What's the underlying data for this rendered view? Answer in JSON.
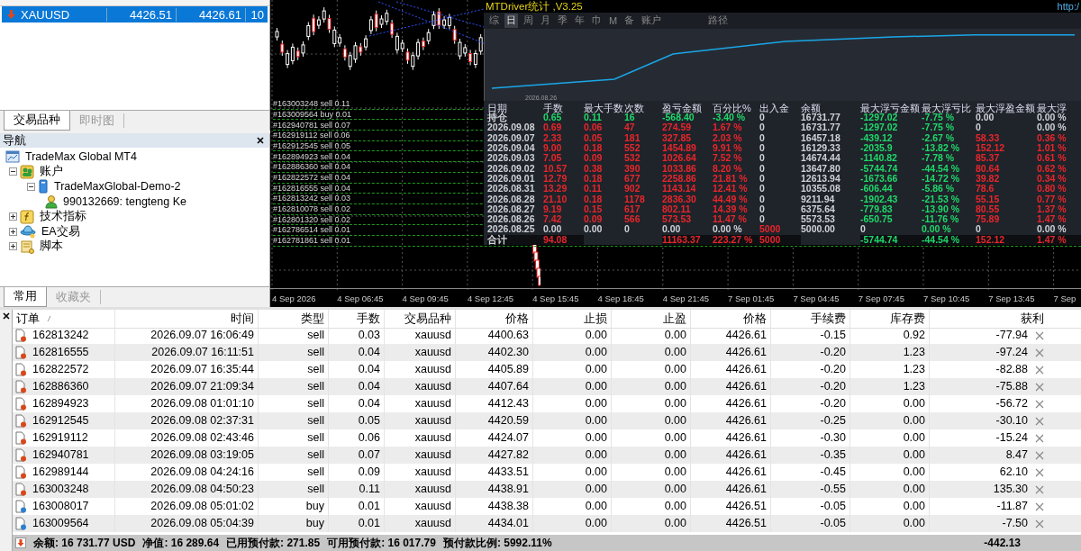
{
  "market_watch": {
    "rows": [
      {
        "symbol": "XAUUSD",
        "bid": "4426.51",
        "ask": "4426.61",
        "spread": "10",
        "selected": true
      }
    ],
    "tabs": [
      {
        "label": "交易品种",
        "selected": true
      },
      {
        "label": "即时图",
        "selected": false
      }
    ]
  },
  "navigator": {
    "title": "导航",
    "tree": {
      "label": "TradeMax Global MT4",
      "kind": "terminal",
      "children": [
        {
          "label": "账户",
          "kind": "accounts",
          "expanded": true,
          "children": [
            {
              "label": "TradeMaxGlobal-Demo-2",
              "kind": "server",
              "expanded": true,
              "children": [
                {
                  "label": "990132669: tengteng Ke",
                  "kind": "user"
                }
              ]
            }
          ]
        },
        {
          "label": "技术指标",
          "kind": "indicators",
          "expanded": false
        },
        {
          "label": "EA交易",
          "kind": "experts",
          "expanded": false
        },
        {
          "label": "脚本",
          "kind": "scripts",
          "expanded": false
        }
      ]
    },
    "tabs": [
      {
        "label": "常用",
        "selected": true
      },
      {
        "label": "收藏夹",
        "selected": false
      }
    ]
  },
  "chart": {
    "order_labels": [
      "#163003248 sell 0.11",
      "#163009564 buy 0.01",
      "#162940781 sell 0.07",
      "#162919112 sell 0.06",
      "#162912545 sell 0.05",
      "#162894923 sell 0.04",
      "#162886360 sell 0.04",
      "#162822572 sell 0.04",
      "#162816555 sell 0.04",
      "#162813242 sell 0.03",
      "#162810078 sell 0.02",
      "#162801320 sell 0.02",
      "#162786514 sell 0.01",
      "#162781861 sell 0.01"
    ],
    "time_axis": [
      "4 Sep 2026",
      "4 Sep 06:45",
      "4 Sep 09:45",
      "4 Sep 12:45",
      "4 Sep 15:45",
      "4 Sep 18:45",
      "4 Sep 21:45",
      "7 Sep 01:45",
      "7 Sep 04:45",
      "7 Sep 07:45",
      "7 Sep 10:45",
      "7 Sep 13:45",
      "7 Sep"
    ]
  },
  "stats_panel": {
    "title": "MTDriver统计 ,V3.25",
    "url": "http:/",
    "tabs": [
      {
        "label": "综",
        "selected": false
      },
      {
        "label": "日",
        "selected": true
      },
      {
        "label": "周",
        "selected": false
      },
      {
        "label": "月",
        "selected": false
      },
      {
        "label": "季",
        "selected": false
      },
      {
        "label": "年",
        "selected": false
      },
      {
        "label": "巾",
        "selected": false
      },
      {
        "label": "M",
        "selected": false
      },
      {
        "label": "备",
        "selected": false
      },
      {
        "label": "账户",
        "selected": false
      },
      {
        "label": "路径",
        "selected": false
      }
    ],
    "curve_start_label": "2026.08.26",
    "columns": [
      "日期",
      "手数",
      "最大手数",
      "次数",
      "盈亏金额",
      "百分比%",
      "出入金",
      "余额",
      "最大浮亏金额",
      "最大浮亏比",
      "最大浮盈金额",
      "最大浮"
    ],
    "rows": [
      {
        "cells": [
          {
            "text": "持仓",
            "color": "#cfd3d8"
          },
          {
            "text": "0.65",
            "color": "#1fd86a"
          },
          {
            "text": "0.11",
            "color": "#1fd86a"
          },
          {
            "text": "16",
            "color": "#1fd86a"
          },
          {
            "text": "-568.40",
            "color": "#1fd86a"
          },
          {
            "text": "-3.40 %",
            "color": "#1fd86a"
          },
          {
            "text": "0",
            "color": "#cfd3d8"
          },
          {
            "text": "16731.77",
            "color": "#cfd3d8"
          },
          {
            "text": "-1297.02",
            "color": "#1fd86a"
          },
          {
            "text": "-7.75 %",
            "color": "#1fd86a"
          },
          {
            "text": "0.00",
            "color": "#cfd3d8"
          },
          {
            "text": "0.00 %",
            "color": "#cfd3d8"
          }
        ]
      },
      {
        "cells": [
          {
            "text": "2026.09.08",
            "color": "#cfd3d8"
          },
          {
            "text": "0.69",
            "color": "#e8262b"
          },
          {
            "text": "0.06",
            "color": "#e8262b"
          },
          {
            "text": "47",
            "color": "#e8262b"
          },
          {
            "text": "274.59",
            "color": "#e8262b"
          },
          {
            "text": "1.67 %",
            "color": "#e8262b"
          },
          {
            "text": "0",
            "color": "#cfd3d8"
          },
          {
            "text": "16731.77",
            "color": "#cfd3d8"
          },
          {
            "text": "-1297.02",
            "color": "#1fd86a"
          },
          {
            "text": "-7.75 %",
            "color": "#1fd86a"
          },
          {
            "text": "0",
            "color": "#cfd3d8"
          },
          {
            "text": "0.00 %",
            "color": "#cfd3d8"
          }
        ]
      },
      {
        "cells": [
          {
            "text": "2026.09.07",
            "color": "#cfd3d8"
          },
          {
            "text": "2.33",
            "color": "#e8262b"
          },
          {
            "text": "0.05",
            "color": "#e8262b"
          },
          {
            "text": "181",
            "color": "#e8262b"
          },
          {
            "text": "327.85",
            "color": "#e8262b"
          },
          {
            "text": "2.03 %",
            "color": "#e8262b"
          },
          {
            "text": "0",
            "color": "#cfd3d8"
          },
          {
            "text": "16457.18",
            "color": "#cfd3d8"
          },
          {
            "text": "-439.12",
            "color": "#1fd86a"
          },
          {
            "text": "-2.67 %",
            "color": "#1fd86a"
          },
          {
            "text": "58.33",
            "color": "#e8262b"
          },
          {
            "text": "0.36 %",
            "color": "#e8262b"
          }
        ]
      },
      {
        "cells": [
          {
            "text": "2026.09.04",
            "color": "#cfd3d8"
          },
          {
            "text": "9.00",
            "color": "#e8262b"
          },
          {
            "text": "0.18",
            "color": "#e8262b"
          },
          {
            "text": "552",
            "color": "#e8262b"
          },
          {
            "text": "1454.89",
            "color": "#e8262b"
          },
          {
            "text": "9.91 %",
            "color": "#e8262b"
          },
          {
            "text": "0",
            "color": "#cfd3d8"
          },
          {
            "text": "16129.33",
            "color": "#cfd3d8"
          },
          {
            "text": "-2035.9",
            "color": "#1fd86a"
          },
          {
            "text": "-13.82 %",
            "color": "#1fd86a"
          },
          {
            "text": "152.12",
            "color": "#e8262b"
          },
          {
            "text": "1.01 %",
            "color": "#e8262b"
          }
        ]
      },
      {
        "cells": [
          {
            "text": "2026.09.03",
            "color": "#cfd3d8"
          },
          {
            "text": "7.05",
            "color": "#e8262b"
          },
          {
            "text": "0.09",
            "color": "#e8262b"
          },
          {
            "text": "532",
            "color": "#e8262b"
          },
          {
            "text": "1026.64",
            "color": "#e8262b"
          },
          {
            "text": "7.52 %",
            "color": "#e8262b"
          },
          {
            "text": "0",
            "color": "#cfd3d8"
          },
          {
            "text": "14674.44",
            "color": "#cfd3d8"
          },
          {
            "text": "-1140.82",
            "color": "#1fd86a"
          },
          {
            "text": "-7.78 %",
            "color": "#1fd86a"
          },
          {
            "text": "85.37",
            "color": "#e8262b"
          },
          {
            "text": "0.61 %",
            "color": "#e8262b"
          }
        ]
      },
      {
        "cells": [
          {
            "text": "2026.09.02",
            "color": "#cfd3d8"
          },
          {
            "text": "10.57",
            "color": "#e8262b"
          },
          {
            "text": "0.38",
            "color": "#e8262b"
          },
          {
            "text": "390",
            "color": "#e8262b"
          },
          {
            "text": "1033.86",
            "color": "#e8262b"
          },
          {
            "text": "8.20 %",
            "color": "#e8262b"
          },
          {
            "text": "0",
            "color": "#cfd3d8"
          },
          {
            "text": "13647.80",
            "color": "#cfd3d8"
          },
          {
            "text": "-5744.74",
            "color": "#1fd86a"
          },
          {
            "text": "-44.54 %",
            "color": "#1fd86a"
          },
          {
            "text": "80.64",
            "color": "#e8262b"
          },
          {
            "text": "0.62 %",
            "color": "#e8262b"
          }
        ]
      },
      {
        "cells": [
          {
            "text": "2026.09.01",
            "color": "#cfd3d8"
          },
          {
            "text": "12.79",
            "color": "#e8262b"
          },
          {
            "text": "0.18",
            "color": "#e8262b"
          },
          {
            "text": "677",
            "color": "#e8262b"
          },
          {
            "text": "2258.86",
            "color": "#e8262b"
          },
          {
            "text": "21.81 %",
            "color": "#e8262b"
          },
          {
            "text": "0",
            "color": "#cfd3d8"
          },
          {
            "text": "12613.94",
            "color": "#cfd3d8"
          },
          {
            "text": "-1673.66",
            "color": "#1fd86a"
          },
          {
            "text": "-14.72 %",
            "color": "#1fd86a"
          },
          {
            "text": "39.82",
            "color": "#e8262b"
          },
          {
            "text": "0.34 %",
            "color": "#e8262b"
          }
        ]
      },
      {
        "cells": [
          {
            "text": "2026.08.31",
            "color": "#cfd3d8"
          },
          {
            "text": "13.29",
            "color": "#e8262b"
          },
          {
            "text": "0.11",
            "color": "#e8262b"
          },
          {
            "text": "902",
            "color": "#e8262b"
          },
          {
            "text": "1143.14",
            "color": "#e8262b"
          },
          {
            "text": "12.41 %",
            "color": "#e8262b"
          },
          {
            "text": "0",
            "color": "#cfd3d8"
          },
          {
            "text": "10355.08",
            "color": "#cfd3d8"
          },
          {
            "text": "-606.44",
            "color": "#1fd86a"
          },
          {
            "text": "-5.86 %",
            "color": "#1fd86a"
          },
          {
            "text": "78.6",
            "color": "#e8262b"
          },
          {
            "text": "0.80 %",
            "color": "#e8262b"
          }
        ]
      },
      {
        "cells": [
          {
            "text": "2026.08.28",
            "color": "#cfd3d8"
          },
          {
            "text": "21.10",
            "color": "#e8262b"
          },
          {
            "text": "0.18",
            "color": "#e8262b"
          },
          {
            "text": "1178",
            "color": "#e8262b"
          },
          {
            "text": "2836.30",
            "color": "#e8262b"
          },
          {
            "text": "44.49 %",
            "color": "#e8262b"
          },
          {
            "text": "0",
            "color": "#cfd3d8"
          },
          {
            "text": "9211.94",
            "color": "#cfd3d8"
          },
          {
            "text": "-1902.43",
            "color": "#1fd86a"
          },
          {
            "text": "-21.53 %",
            "color": "#1fd86a"
          },
          {
            "text": "55.15",
            "color": "#e8262b"
          },
          {
            "text": "0.77 %",
            "color": "#e8262b"
          }
        ]
      },
      {
        "cells": [
          {
            "text": "2026.08.27",
            "color": "#cfd3d8"
          },
          {
            "text": "9.19",
            "color": "#e8262b"
          },
          {
            "text": "0.15",
            "color": "#e8262b"
          },
          {
            "text": "617",
            "color": "#e8262b"
          },
          {
            "text": "802.11",
            "color": "#e8262b"
          },
          {
            "text": "14.39 %",
            "color": "#e8262b"
          },
          {
            "text": "0",
            "color": "#cfd3d8"
          },
          {
            "text": "6375.64",
            "color": "#cfd3d8"
          },
          {
            "text": "-779.83",
            "color": "#1fd86a"
          },
          {
            "text": "-13.90 %",
            "color": "#1fd86a"
          },
          {
            "text": "80.55",
            "color": "#e8262b"
          },
          {
            "text": "1.37 %",
            "color": "#e8262b"
          }
        ]
      },
      {
        "cells": [
          {
            "text": "2026.08.26",
            "color": "#cfd3d8"
          },
          {
            "text": "7.42",
            "color": "#e8262b"
          },
          {
            "text": "0.09",
            "color": "#e8262b"
          },
          {
            "text": "566",
            "color": "#e8262b"
          },
          {
            "text": "573.53",
            "color": "#e8262b"
          },
          {
            "text": "11.47 %",
            "color": "#e8262b"
          },
          {
            "text": "0",
            "color": "#cfd3d8"
          },
          {
            "text": "5573.53",
            "color": "#cfd3d8"
          },
          {
            "text": "-650.75",
            "color": "#1fd86a"
          },
          {
            "text": "-11.76 %",
            "color": "#1fd86a"
          },
          {
            "text": "75.89",
            "color": "#e8262b"
          },
          {
            "text": "1.47 %",
            "color": "#e8262b"
          }
        ]
      },
      {
        "cells": [
          {
            "text": "2026.08.25",
            "color": "#cfd3d8"
          },
          {
            "text": "0.00",
            "color": "#cfd3d8"
          },
          {
            "text": "0.00",
            "color": "#cfd3d8"
          },
          {
            "text": "0",
            "color": "#cfd3d8"
          },
          {
            "text": "0.00",
            "color": "#cfd3d8"
          },
          {
            "text": "0.00 %",
            "color": "#cfd3d8"
          },
          {
            "text": "5000",
            "color": "#e8262b"
          },
          {
            "text": "5000.00",
            "color": "#cfd3d8"
          },
          {
            "text": "0",
            "color": "#cfd3d8"
          },
          {
            "text": "0.00 %",
            "color": "#1fd86a"
          },
          {
            "text": "0",
            "color": "#cfd3d8"
          },
          {
            "text": "0.00 %",
            "color": "#cfd3d8"
          }
        ]
      },
      {
        "total": true,
        "cells": [
          {
            "text": "合计",
            "color": "#cfd3d8"
          },
          {
            "text": "94.08",
            "color": "#e8262b"
          },
          null,
          null,
          {
            "text": "11163.37",
            "color": "#e8262b"
          },
          {
            "text": "223.27 %",
            "color": "#e8262b"
          },
          {
            "text": "5000",
            "color": "#e8262b"
          },
          null,
          {
            "text": "-5744.74",
            "color": "#1fd86a"
          },
          {
            "text": "-44.54 %",
            "color": "#1fd86a"
          },
          {
            "text": "152.12",
            "color": "#e8262b"
          },
          {
            "text": "1.47 %",
            "color": "#e8262b"
          }
        ]
      }
    ]
  },
  "terminal": {
    "columns": [
      "订单",
      "时间",
      "类型",
      "手数",
      "交易品种",
      "价格",
      "止损",
      "止盈",
      "价格",
      "手续费",
      "库存费",
      "获利"
    ],
    "rows": [
      {
        "kind": "sell",
        "order": "162813242",
        "time": "2026.09.07 16:06:49",
        "type": "sell",
        "lots": "0.03",
        "symbol": "xauusd",
        "open_price": "4400.63",
        "sl": "0.00",
        "tp": "0.00",
        "price": "4426.61",
        "commission": "-0.15",
        "swap": "0.92",
        "profit": "-77.94"
      },
      {
        "kind": "sell",
        "order": "162816555",
        "time": "2026.09.07 16:11:51",
        "type": "sell",
        "lots": "0.04",
        "symbol": "xauusd",
        "open_price": "4402.30",
        "sl": "0.00",
        "tp": "0.00",
        "price": "4426.61",
        "commission": "-0.20",
        "swap": "1.23",
        "profit": "-97.24"
      },
      {
        "kind": "sell",
        "order": "162822572",
        "time": "2026.09.07 16:35:44",
        "type": "sell",
        "lots": "0.04",
        "symbol": "xauusd",
        "open_price": "4405.89",
        "sl": "0.00",
        "tp": "0.00",
        "price": "4426.61",
        "commission": "-0.20",
        "swap": "1.23",
        "profit": "-82.88"
      },
      {
        "kind": "sell",
        "order": "162886360",
        "time": "2026.09.07 21:09:34",
        "type": "sell",
        "lots": "0.04",
        "symbol": "xauusd",
        "open_price": "4407.64",
        "sl": "0.00",
        "tp": "0.00",
        "price": "4426.61",
        "commission": "-0.20",
        "swap": "1.23",
        "profit": "-75.88"
      },
      {
        "kind": "sell",
        "order": "162894923",
        "time": "2026.09.08 01:01:10",
        "type": "sell",
        "lots": "0.04",
        "symbol": "xauusd",
        "open_price": "4412.43",
        "sl": "0.00",
        "tp": "0.00",
        "price": "4426.61",
        "commission": "-0.20",
        "swap": "0.00",
        "profit": "-56.72"
      },
      {
        "kind": "sell",
        "order": "162912545",
        "time": "2026.09.08 02:37:31",
        "type": "sell",
        "lots": "0.05",
        "symbol": "xauusd",
        "open_price": "4420.59",
        "sl": "0.00",
        "tp": "0.00",
        "price": "4426.61",
        "commission": "-0.25",
        "swap": "0.00",
        "profit": "-30.10"
      },
      {
        "kind": "sell",
        "order": "162919112",
        "time": "2026.09.08 02:43:46",
        "type": "sell",
        "lots": "0.06",
        "symbol": "xauusd",
        "open_price": "4424.07",
        "sl": "0.00",
        "tp": "0.00",
        "price": "4426.61",
        "commission": "-0.30",
        "swap": "0.00",
        "profit": "-15.24"
      },
      {
        "kind": "sell",
        "order": "162940781",
        "time": "2026.09.08 03:19:05",
        "type": "sell",
        "lots": "0.07",
        "symbol": "xauusd",
        "open_price": "4427.82",
        "sl": "0.00",
        "tp": "0.00",
        "price": "4426.61",
        "commission": "-0.35",
        "swap": "0.00",
        "profit": "8.47"
      },
      {
        "kind": "sell",
        "order": "162989144",
        "time": "2026.09.08 04:24:16",
        "type": "sell",
        "lots": "0.09",
        "symbol": "xauusd",
        "open_price": "4433.51",
        "sl": "0.00",
        "tp": "0.00",
        "price": "4426.61",
        "commission": "-0.45",
        "swap": "0.00",
        "profit": "62.10"
      },
      {
        "kind": "sell",
        "order": "163003248",
        "time": "2026.09.08 04:50:23",
        "type": "sell",
        "lots": "0.11",
        "symbol": "xauusd",
        "open_price": "4438.91",
        "sl": "0.00",
        "tp": "0.00",
        "price": "4426.61",
        "commission": "-0.55",
        "swap": "0.00",
        "profit": "135.30"
      },
      {
        "kind": "buy",
        "order": "163008017",
        "time": "2026.09.08 05:01:02",
        "type": "buy",
        "lots": "0.01",
        "symbol": "xauusd",
        "open_price": "4438.38",
        "sl": "0.00",
        "tp": "0.00",
        "price": "4426.51",
        "commission": "-0.05",
        "swap": "0.00",
        "profit": "-11.87"
      },
      {
        "kind": "buy",
        "order": "163009564",
        "time": "2026.09.08 05:04:39",
        "type": "buy",
        "lots": "0.01",
        "symbol": "xauusd",
        "open_price": "4434.01",
        "sl": "0.00",
        "tp": "0.00",
        "price": "4426.51",
        "commission": "-0.05",
        "swap": "0.00",
        "profit": "-7.50"
      }
    ],
    "status": {
      "items": [
        "余额: 16 731.77 USD",
        "净值: 16 289.64",
        "已用预付款: 271.85",
        "可用预付款: 16 017.79",
        "预付款比例: 5992.11%"
      ],
      "total": "-442.13"
    }
  }
}
